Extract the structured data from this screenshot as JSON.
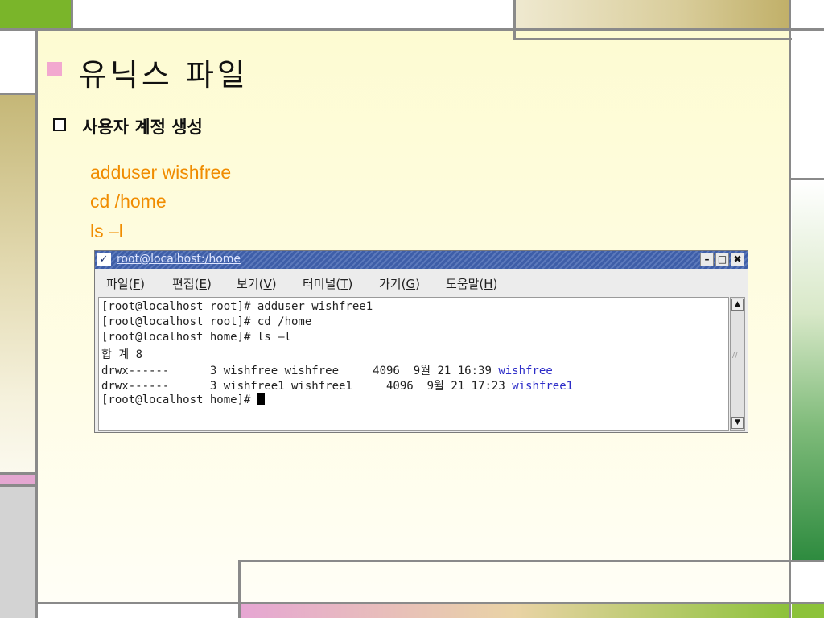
{
  "slide": {
    "title": "유닉스 파일",
    "subtitle": "사용자 계정 생성",
    "commands": [
      "adduser wishfree",
      "cd /home",
      "ls –l"
    ]
  },
  "terminal": {
    "window_title": "root@localhost:/home",
    "menu": [
      {
        "label": "파일(",
        "key": "F",
        "end": ")"
      },
      {
        "label": "편집(",
        "key": "E",
        "end": ")"
      },
      {
        "label": "보기(",
        "key": "V",
        "end": ")"
      },
      {
        "label": "터미널(",
        "key": "T",
        "end": ")"
      },
      {
        "label": "가기(",
        "key": "G",
        "end": ")"
      },
      {
        "label": "도움말(",
        "key": "H",
        "end": ")"
      }
    ],
    "lines": [
      "[root@localhost root]# adduser wishfree1",
      "[root@localhost root]# cd /home",
      "[root@localhost home]# ls –l",
      "합 계 8"
    ],
    "listing": [
      {
        "prefix": "drwx------      3 wishfree wishfree     4096  9월 21 16:39 ",
        "name": "wishfree"
      },
      {
        "prefix": "drwx------      3 wishfree1 wishfree1     4096  9월 21 17:23 ",
        "name": "wishfree1"
      }
    ],
    "prompt": "[root@localhost home]# "
  },
  "colors": {
    "command_text": "#f08c00",
    "dir_highlight": "#2c2cc8",
    "accent_green": "#7ab52a",
    "accent_pink": "#f2a8cf"
  },
  "icons": [
    "window-menu-icon",
    "minimize-icon",
    "maximize-icon",
    "close-icon",
    "scroll-up-icon",
    "scroll-down-icon"
  ]
}
